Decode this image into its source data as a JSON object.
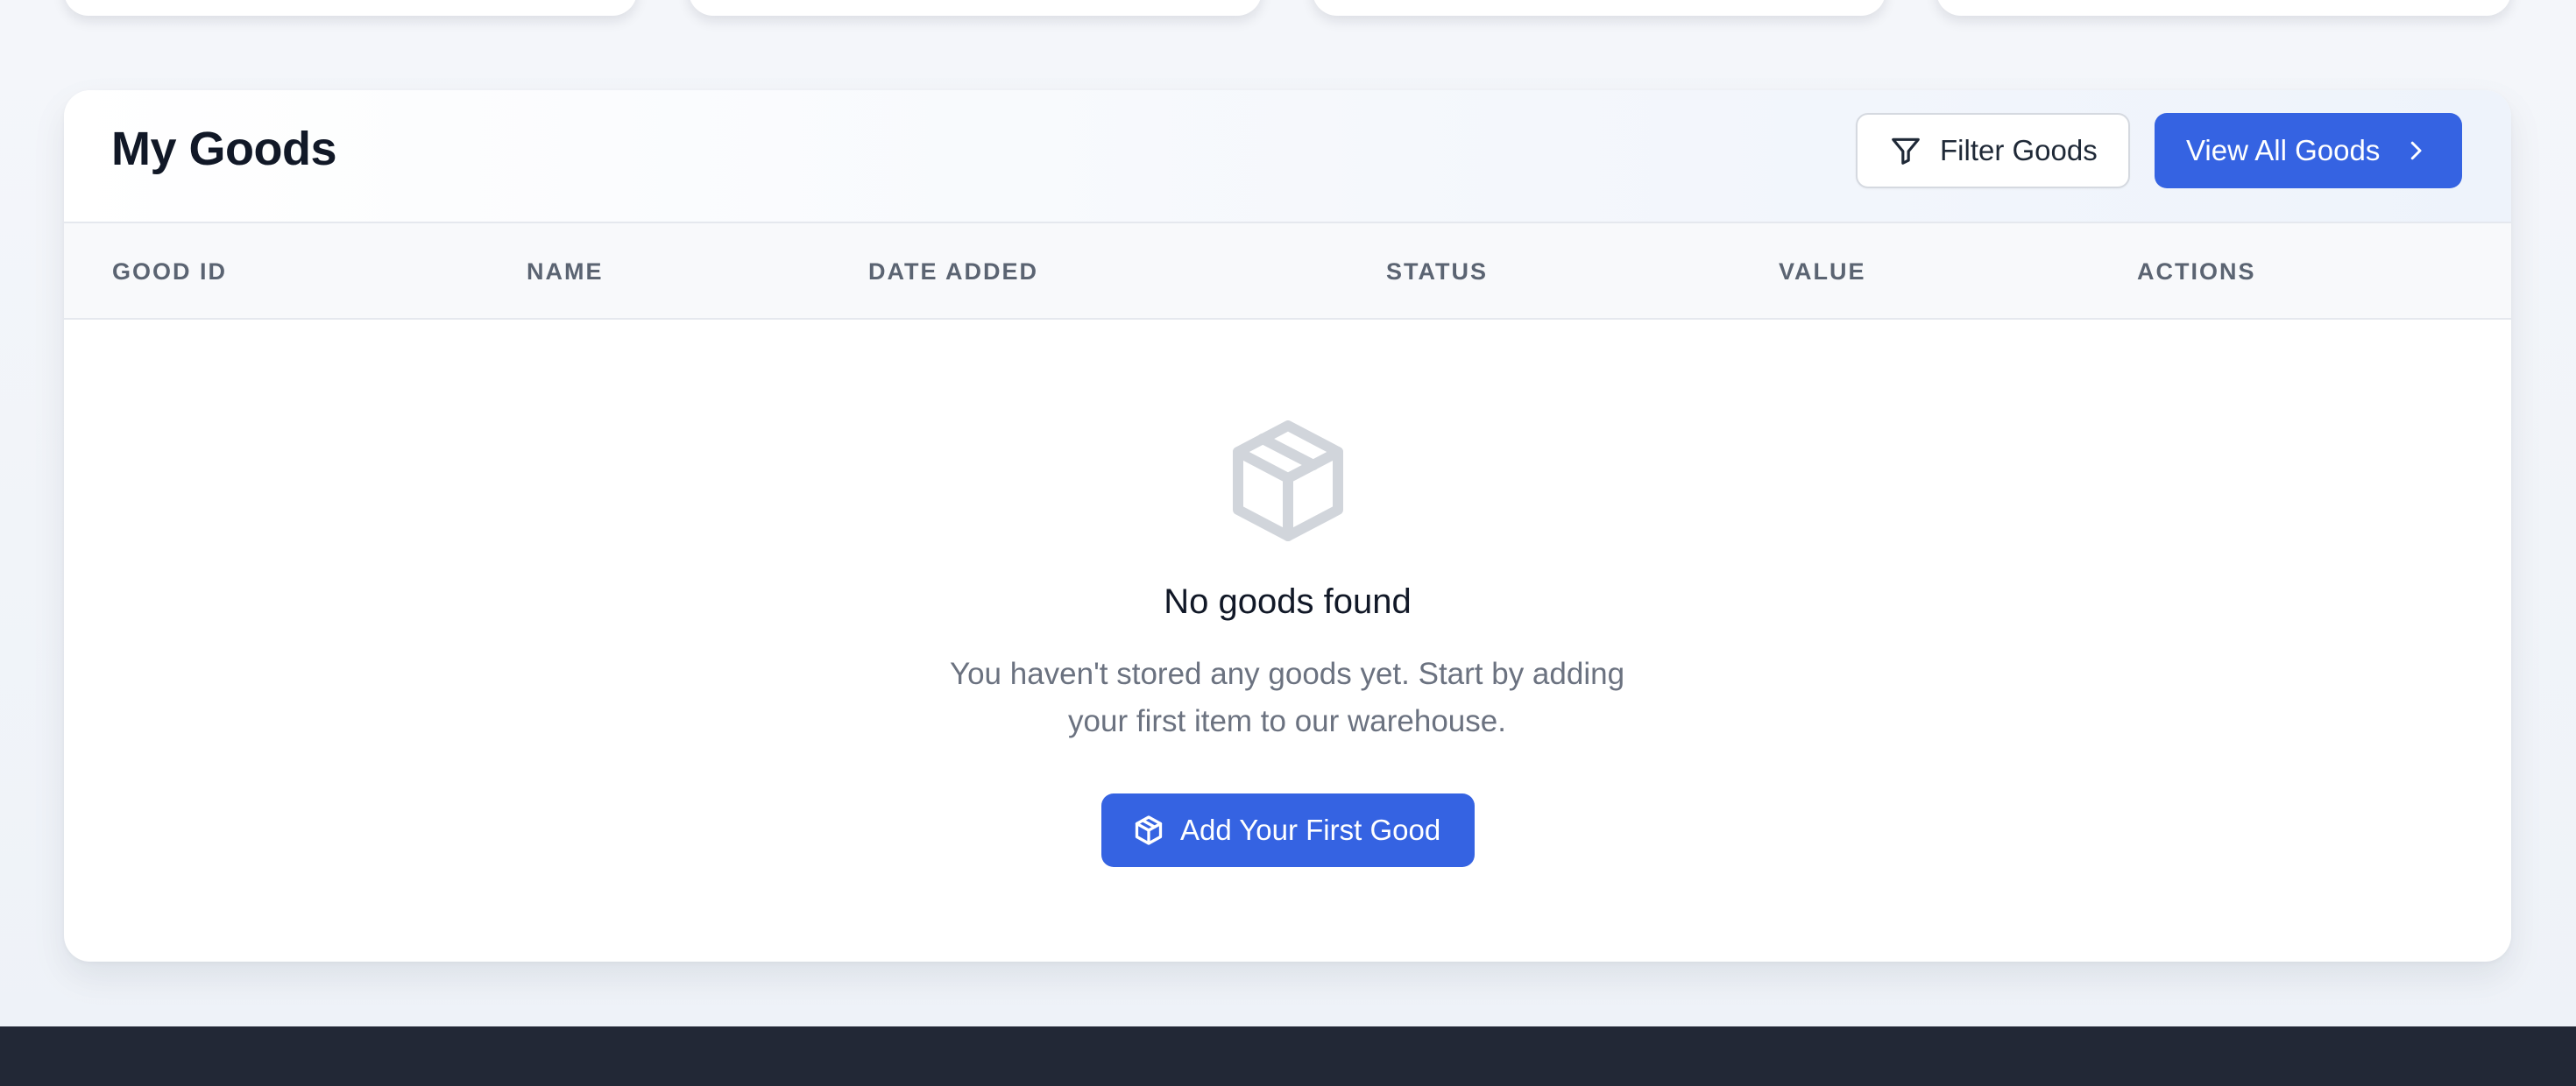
{
  "stat_cards": [
    {},
    {},
    {},
    {}
  ],
  "goods": {
    "title": "My Goods",
    "filter_button": {
      "label": "Filter Goods",
      "icon": "filter-icon"
    },
    "view_all_button": {
      "label": "View All Goods",
      "icon": "chevron-right-icon"
    },
    "columns": [
      "GOOD ID",
      "NAME",
      "DATE ADDED",
      "STATUS",
      "VALUE",
      "ACTIONS"
    ],
    "empty_state": {
      "icon": "package-icon",
      "title": "No goods found",
      "description_line1": "You haven't stored any goods yet. Start by adding",
      "description_line2": "your first item to our warehouse.",
      "button": {
        "label": "Add Your First Good",
        "icon": "package-icon"
      }
    }
  },
  "colors": {
    "primary": "#3563e2",
    "title_text": "#111827",
    "muted_text": "#6b7280",
    "header_text": "#5b6472",
    "footer_bg": "#222836",
    "empty_icon": "#d1d5db"
  }
}
